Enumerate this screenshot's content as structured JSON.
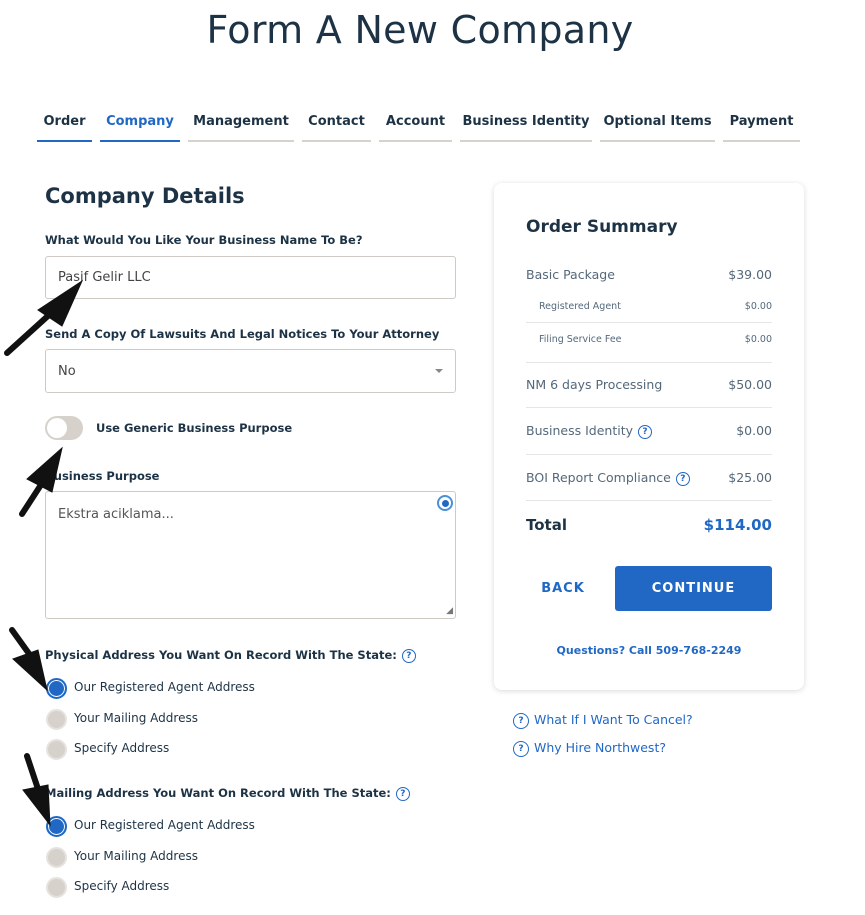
{
  "title": "Form A New Company",
  "tabs": [
    {
      "label": "Order"
    },
    {
      "label": "Company"
    },
    {
      "label": "Management"
    },
    {
      "label": "Contact"
    },
    {
      "label": "Account"
    },
    {
      "label": "Business Identity"
    },
    {
      "label": "Optional Items"
    },
    {
      "label": "Payment"
    }
  ],
  "section_title": "Company Details",
  "business_name": {
    "label": "What Would You Like Your Business Name To Be?",
    "value": "Pasif Gelir LLC"
  },
  "attorney": {
    "label": "Send A Copy Of Lawsuits And Legal Notices To Your Attorney",
    "value": "No"
  },
  "generic_purpose": {
    "label": "Use Generic Business Purpose",
    "on": false
  },
  "purpose": {
    "label": "Business Purpose",
    "placeholder": "Ekstra aciklama..."
  },
  "physical": {
    "label": "Physical Address You Want On Record With The State:",
    "options": [
      "Our Registered Agent Address",
      "Your Mailing Address",
      "Specify Address"
    ],
    "selected": 0
  },
  "mailing": {
    "label": "Mailing Address You Want On Record With The State:",
    "options": [
      "Our Registered Agent Address",
      "Your Mailing Address",
      "Specify Address"
    ],
    "selected": 0
  },
  "summary": {
    "title": "Order Summary",
    "items": [
      {
        "name": "Basic Package",
        "price": "$39.00"
      },
      {
        "name": "Registered Agent",
        "price": "$0.00"
      },
      {
        "name": "Filing Service Fee",
        "price": "$0.00"
      },
      {
        "name": "NM 6 days Processing",
        "price": "$50.00"
      },
      {
        "name": "Business Identity",
        "price": "$0.00"
      },
      {
        "name": "BOI Report Compliance",
        "price": "$25.00"
      }
    ],
    "total_label": "Total",
    "total": "$114.00",
    "back": "BACK",
    "continue": "CONTINUE",
    "questions": "Questions? Call 509-768-2249"
  },
  "links": [
    "What If I Want To Cancel?",
    "Why Hire Northwest?"
  ],
  "colors": {
    "accent": "#2168c5",
    "text": "#1d3345"
  }
}
